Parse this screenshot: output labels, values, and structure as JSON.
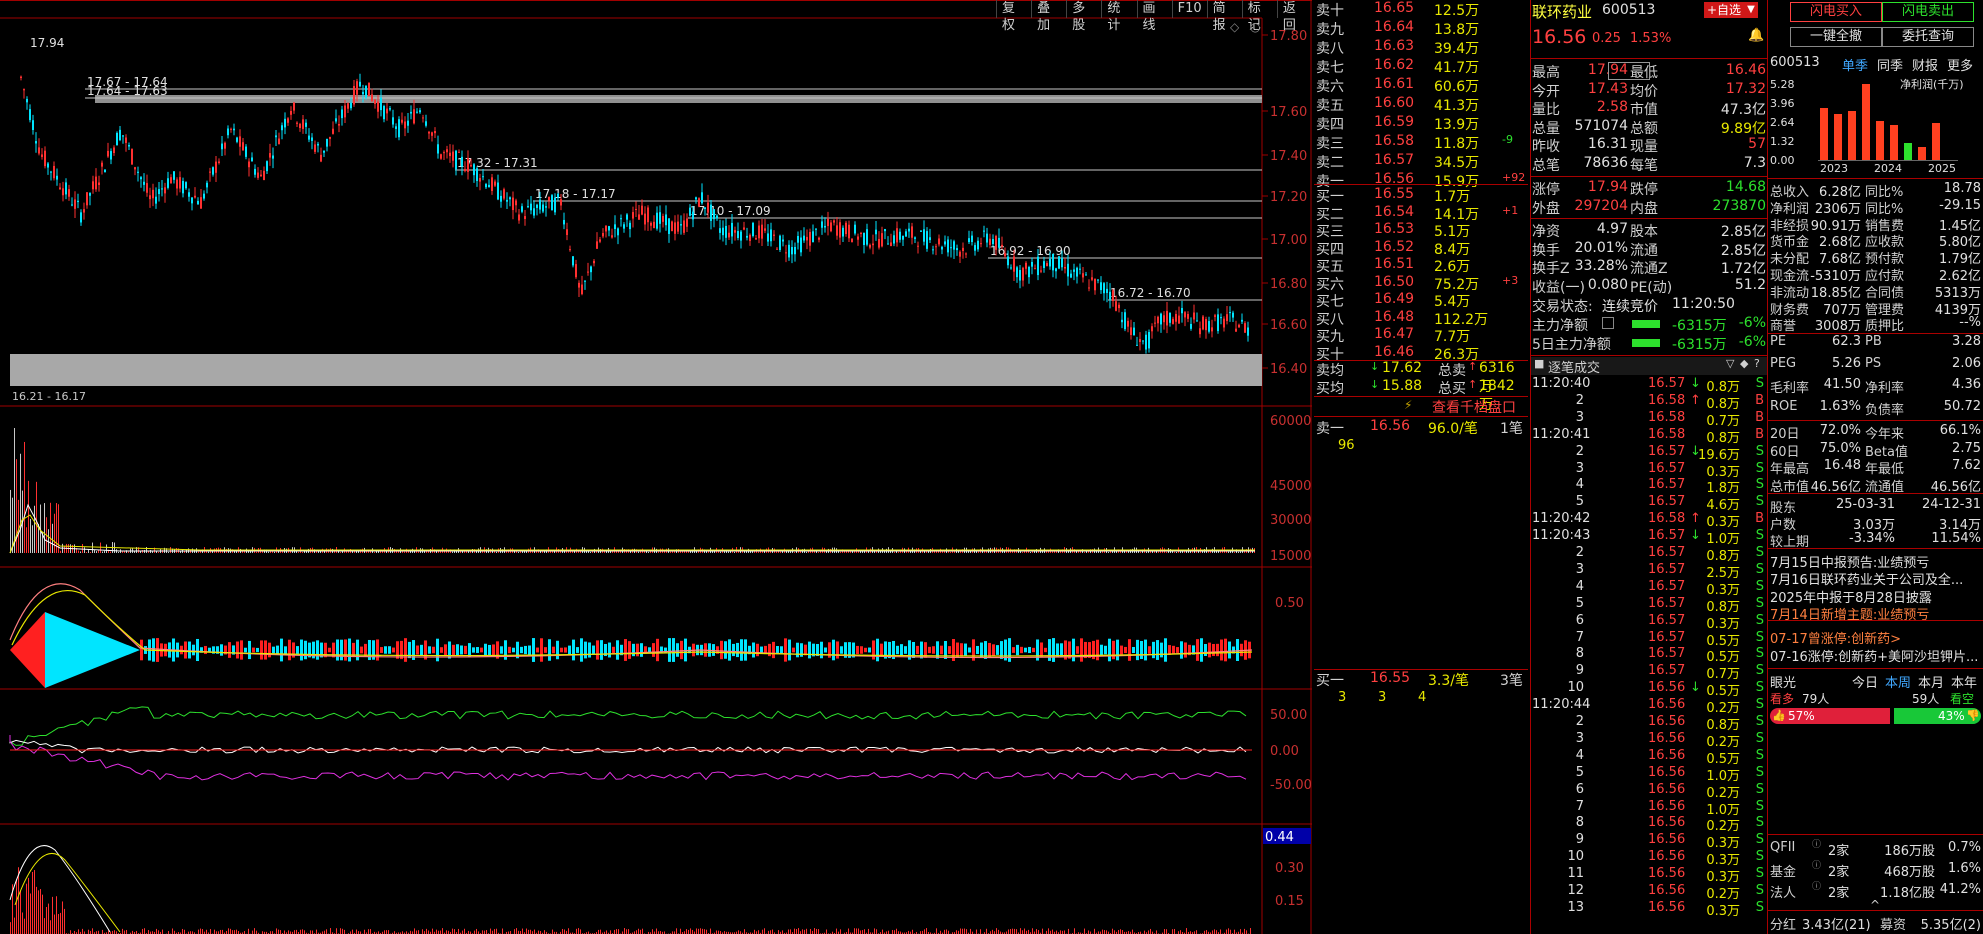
{
  "toolbar": {
    "items": [
      "复权",
      "叠加",
      "多股",
      "统计",
      "画线",
      "F10",
      "简报",
      "标记",
      "返回"
    ]
  },
  "chart": {
    "price_axis": [
      "17.80",
      "17.60",
      "17.40",
      "17.20",
      "17.00",
      "16.80",
      "16.60",
      "16.40"
    ],
    "vol_axis": [
      "60000",
      "45000",
      "30000",
      "15000"
    ],
    "macd_axis": [
      "0.50"
    ],
    "ind_axis": [
      "50.00",
      "0.00",
      "-50.00"
    ],
    "ind2_axis": [
      "0.44",
      "0.30",
      "0.15"
    ],
    "high_label": "17.94",
    "zones": [
      "17.67 - 17.64",
      "17.64 - 17.63",
      "17.32 - 17.31",
      "17.18 - 17.17",
      "17.10 - 17.09",
      "16.92 - 16.90",
      "16.72 - 16.70"
    ],
    "cutoff_label": "16.21 - 16.17",
    "colors": {
      "up": "#ff3030",
      "down": "#00e5ff",
      "grid": "#a00000"
    }
  },
  "book": {
    "asks": [
      {
        "name": "卖十",
        "price": "16.65",
        "vol": "12.5万",
        "chg": ""
      },
      {
        "name": "卖九",
        "price": "16.64",
        "vol": "13.8万",
        "chg": ""
      },
      {
        "name": "卖八",
        "price": "16.63",
        "vol": "39.4万",
        "chg": ""
      },
      {
        "name": "卖七",
        "price": "16.62",
        "vol": "41.7万",
        "chg": ""
      },
      {
        "name": "卖六",
        "price": "16.61",
        "vol": "60.6万",
        "chg": ""
      },
      {
        "name": "卖五",
        "price": "16.60",
        "vol": "41.3万",
        "chg": ""
      },
      {
        "name": "卖四",
        "price": "16.59",
        "vol": "13.9万",
        "chg": ""
      },
      {
        "name": "卖三",
        "price": "16.58",
        "vol": "11.8万",
        "chg": "-9"
      },
      {
        "name": "卖二",
        "price": "16.57",
        "vol": "34.5万",
        "chg": ""
      },
      {
        "name": "卖一",
        "price": "16.56",
        "vol": "15.9万",
        "chg": "+92"
      }
    ],
    "bids": [
      {
        "name": "买一",
        "price": "16.55",
        "vol": "1.7万",
        "chg": ""
      },
      {
        "name": "买二",
        "price": "16.54",
        "vol": "14.1万",
        "chg": "+1"
      },
      {
        "name": "买三",
        "price": "16.53",
        "vol": "5.1万",
        "chg": ""
      },
      {
        "name": "买四",
        "price": "16.52",
        "vol": "8.4万",
        "chg": ""
      },
      {
        "name": "买五",
        "price": "16.51",
        "vol": "2.6万",
        "chg": ""
      },
      {
        "name": "买六",
        "price": "16.50",
        "vol": "75.2万",
        "chg": "+3"
      },
      {
        "name": "买七",
        "price": "16.49",
        "vol": "5.4万",
        "chg": ""
      },
      {
        "name": "买八",
        "price": "16.48",
        "vol": "112.2万",
        "chg": ""
      },
      {
        "name": "买九",
        "price": "16.47",
        "vol": "7.7万",
        "chg": ""
      },
      {
        "name": "买十",
        "price": "16.46",
        "vol": "26.3万",
        "chg": ""
      }
    ],
    "avg_sell_label": "卖均",
    "avg_sell": "17.62",
    "total_sell_label": "总卖",
    "total_sell": "6316万",
    "avg_buy_label": "买均",
    "avg_buy": "15.88",
    "total_buy_label": "总买",
    "total_buy": "1842万",
    "view_1000": "查看千档盘口",
    "ask1_label": "卖一",
    "ask1_price": "16.56",
    "ask1_amt": "96.0/笔",
    "ask1_cnt": "1笔",
    "ask1_detail": "96",
    "bid1_label": "买一",
    "bid1_price": "16.55",
    "bid1_amt": "3.3/笔",
    "bid1_cnt": "3笔",
    "bid1_detail": [
      "3",
      "3",
      "4"
    ]
  },
  "quote": {
    "name": "联环药业",
    "code": "600513",
    "add_watch": "+自选",
    "price": "16.56",
    "change": "0.25",
    "pct": "1.53%",
    "rows": [
      [
        "最高",
        "17.94",
        "最低",
        "16.46"
      ],
      [
        "今开",
        "17.43",
        "均价",
        "17.32"
      ],
      [
        "量比",
        "2.58",
        "市值",
        "47.3亿"
      ],
      [
        "总量",
        "571074",
        "总额",
        "9.89亿"
      ],
      [
        "昨收",
        "16.31",
        "现量",
        "57"
      ],
      [
        "总笔",
        "78636",
        "每笔",
        "7.3"
      ]
    ],
    "rows2": [
      [
        "涨停",
        "17.94",
        "跌停",
        "14.68"
      ],
      [
        "外盘",
        "297204",
        "内盘",
        "273870"
      ]
    ],
    "rows3": [
      [
        "净资",
        "4.97",
        "股本",
        "2.85亿"
      ],
      [
        "换手",
        "20.01%",
        "流通",
        "2.85亿"
      ],
      [
        "换手Z",
        "33.28%",
        "流通Z",
        "1.72亿"
      ],
      [
        "收益(一)",
        "0.080",
        "PE(动)",
        "51.2"
      ]
    ],
    "status_label": "交易状态:",
    "status": "连续竞价",
    "status_time": "11:20:50",
    "flow1_label": "主力净额",
    "flow1": "-6315万",
    "flow1_pct": "-6%",
    "flow2_label": "5日主力净额",
    "flow2": "-6315万",
    "flow2_pct": "-6%",
    "trades_title": "逐笔成交",
    "trades": [
      {
        "t": "11:20:40",
        "p": "16.57",
        "a": "↓",
        "v": "0.8万",
        "s": "S"
      },
      {
        "t": "2",
        "p": "16.58",
        "a": "↑",
        "v": "0.8万",
        "s": "B"
      },
      {
        "t": "3",
        "p": "16.58",
        "a": "",
        "v": "0.7万",
        "s": "B"
      },
      {
        "t": "11:20:41",
        "p": "16.58",
        "a": "",
        "v": "0.8万",
        "s": "B"
      },
      {
        "t": "2",
        "p": "16.57",
        "a": "↓",
        "v": "19.6万",
        "s": "S"
      },
      {
        "t": "3",
        "p": "16.57",
        "a": "",
        "v": "0.3万",
        "s": "S"
      },
      {
        "t": "4",
        "p": "16.57",
        "a": "",
        "v": "1.8万",
        "s": "S"
      },
      {
        "t": "5",
        "p": "16.57",
        "a": "",
        "v": "4.6万",
        "s": "S"
      },
      {
        "t": "11:20:42",
        "p": "16.58",
        "a": "↑",
        "v": "0.3万",
        "s": "B"
      },
      {
        "t": "11:20:43",
        "p": "16.57",
        "a": "↓",
        "v": "1.0万",
        "s": "S"
      },
      {
        "t": "2",
        "p": "16.57",
        "a": "",
        "v": "0.8万",
        "s": "S"
      },
      {
        "t": "3",
        "p": "16.57",
        "a": "",
        "v": "2.5万",
        "s": "S"
      },
      {
        "t": "4",
        "p": "16.57",
        "a": "",
        "v": "0.3万",
        "s": "S"
      },
      {
        "t": "5",
        "p": "16.57",
        "a": "",
        "v": "0.8万",
        "s": "S"
      },
      {
        "t": "6",
        "p": "16.57",
        "a": "",
        "v": "0.3万",
        "s": "S"
      },
      {
        "t": "7",
        "p": "16.57",
        "a": "",
        "v": "0.5万",
        "s": "S"
      },
      {
        "t": "8",
        "p": "16.57",
        "a": "",
        "v": "0.5万",
        "s": "S"
      },
      {
        "t": "9",
        "p": "16.57",
        "a": "",
        "v": "0.7万",
        "s": "S"
      },
      {
        "t": "10",
        "p": "16.56",
        "a": "↓",
        "v": "0.5万",
        "s": "S"
      },
      {
        "t": "11:20:44",
        "p": "16.56",
        "a": "",
        "v": "0.2万",
        "s": "S"
      },
      {
        "t": "2",
        "p": "16.56",
        "a": "",
        "v": "0.8万",
        "s": "S"
      },
      {
        "t": "3",
        "p": "16.56",
        "a": "",
        "v": "0.2万",
        "s": "S"
      },
      {
        "t": "4",
        "p": "16.56",
        "a": "",
        "v": "0.5万",
        "s": "S"
      },
      {
        "t": "5",
        "p": "16.56",
        "a": "",
        "v": "1.0万",
        "s": "S"
      },
      {
        "t": "6",
        "p": "16.56",
        "a": "",
        "v": "0.2万",
        "s": "S"
      },
      {
        "t": "7",
        "p": "16.56",
        "a": "",
        "v": "1.0万",
        "s": "S"
      },
      {
        "t": "8",
        "p": "16.56",
        "a": "",
        "v": "0.2万",
        "s": "S"
      },
      {
        "t": "9",
        "p": "16.56",
        "a": "",
        "v": "0.3万",
        "s": "S"
      },
      {
        "t": "10",
        "p": "16.56",
        "a": "",
        "v": "0.3万",
        "s": "S"
      },
      {
        "t": "11",
        "p": "16.56",
        "a": "",
        "v": "0.3万",
        "s": "S"
      },
      {
        "t": "12",
        "p": "16.56",
        "a": "",
        "v": "0.2万",
        "s": "S"
      },
      {
        "t": "13",
        "p": "16.56",
        "a": "",
        "v": "0.3万",
        "s": "S"
      }
    ]
  },
  "f10": {
    "flash_buy": "闪电买入",
    "flash_sell": "闪电卖出",
    "cancel_all": "一键全撤",
    "entrust_query": "委托查询",
    "code": "600513",
    "tabs": [
      "单季",
      "同季",
      "财报",
      "更多"
    ],
    "profit_title": "净利润(千万)",
    "profit_axis": [
      "5.28",
      "3.96",
      "2.64",
      "1.32",
      "0.00"
    ],
    "profit_years": [
      "2023",
      "2024",
      "2025"
    ],
    "profit_values": [
      3.6,
      3.2,
      3.4,
      5.28,
      2.7,
      2.4,
      1.2,
      0.9,
      2.6
    ],
    "fin": [
      [
        "总收入",
        "6.28亿",
        "同比%",
        "18.78"
      ],
      [
        "净利润",
        "2306万",
        "同比%",
        "-29.15"
      ],
      [
        "非经损",
        "90.91万",
        "销售费",
        "1.45亿"
      ],
      [
        "货币金",
        "2.68亿",
        "应收款",
        "5.80亿"
      ],
      [
        "未分配",
        "7.68亿",
        "预付款",
        "1.79亿"
      ],
      [
        "现金流",
        "-5310万",
        "应付款",
        "2.62亿"
      ],
      [
        "非流动",
        "18.85亿",
        "合同债",
        "5313万"
      ],
      [
        "财务费",
        "707万",
        "管理费",
        "4139万"
      ],
      [
        "商誉",
        "3008万",
        "质押比",
        "--%"
      ]
    ],
    "ratios": [
      [
        "PE",
        "62.3",
        "PB",
        "3.28"
      ],
      [
        "PEG",
        "5.26",
        "PS",
        "2.06"
      ],
      [
        "毛利率",
        "41.50",
        "净利率",
        "4.36"
      ],
      [
        "ROE",
        "1.63%",
        "负债率",
        "50.72"
      ]
    ],
    "perf": [
      [
        "20日",
        "72.0%",
        "今年来",
        "66.1%"
      ],
      [
        "60日",
        "75.0%",
        "Beta值",
        "2.75"
      ],
      [
        "年最高",
        "16.48",
        "年最低",
        "7.62"
      ],
      [
        "总市值",
        "46.56亿",
        "流通值",
        "46.56亿"
      ]
    ],
    "holders": [
      [
        "股东",
        "25-03-31",
        "24-12-31"
      ],
      [
        "户数",
        "3.03万",
        "3.14万"
      ],
      [
        "较上期",
        "-3.34%",
        "11.54%"
      ]
    ],
    "news": [
      "7月15日中报预告:业绩预亏",
      "7月16日联环药业关于公司及全...",
      "2025年中报于8月28日披露",
      "7月14日新增主题:业绩预亏"
    ],
    "limit_news": [
      "07-17曾涨停:创新药>",
      "07-16涨停:创新药+美阿沙坦钾片..."
    ],
    "vision_label": "眼光",
    "vision_tabs": [
      "今日",
      "本周",
      "本月",
      "本年"
    ],
    "bull_label": "看多",
    "bull_count": "79人",
    "bear_count": "59人",
    "bear_label": "看空",
    "bull_pct": "57%",
    "bear_pct": "43%",
    "bull_frac": 0.57,
    "inst": [
      [
        "QFII",
        "2家",
        "186万股",
        "0.7%"
      ],
      [
        "基金",
        "2家",
        "468万股",
        "1.6%"
      ],
      [
        "法人",
        "2家",
        "1.18亿股",
        "41.2%"
      ]
    ],
    "dividend_label": "分红",
    "dividend": "3.43亿(21)",
    "financing_label": "募资",
    "financing": "5.35亿(2)"
  }
}
